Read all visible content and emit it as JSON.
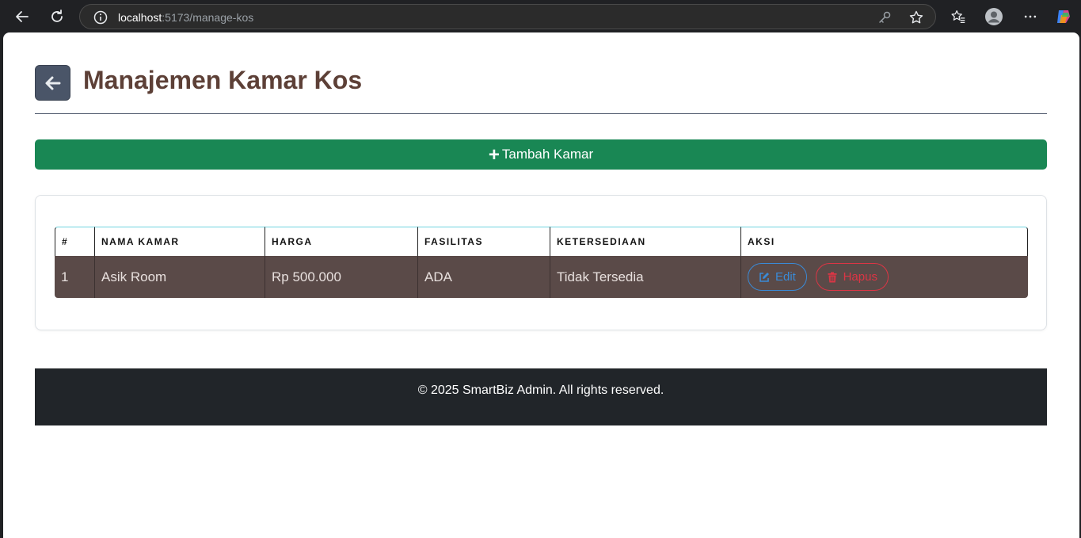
{
  "browser": {
    "url_host": "localhost",
    "url_path": ":5173/manage-kos"
  },
  "header": {
    "title": "Manajemen Kamar Kos"
  },
  "actions": {
    "add_plus": "+",
    "add_label": "Tambah Kamar"
  },
  "table": {
    "columns": [
      "#",
      "NAMA KAMAR",
      "HARGA",
      "FASILITAS",
      "KETERSEDIAAN",
      "AKSI"
    ],
    "rows": [
      {
        "no": "1",
        "nama": "Asik Room",
        "harga": "Rp 500.000",
        "fasilitas": "ADA",
        "ketersediaan": "Tidak Tersedia",
        "edit_label": "Edit",
        "delete_label": "Hapus"
      }
    ]
  },
  "footer": {
    "text": "© 2025 SmartBiz Admin. All rights reserved."
  },
  "colors": {
    "title": "#5d4037",
    "add_button": "#198754",
    "row_bg": "#5a4a48",
    "edit": "#3a8ad6",
    "delete": "#dc3545",
    "footer_bg": "#212529"
  }
}
